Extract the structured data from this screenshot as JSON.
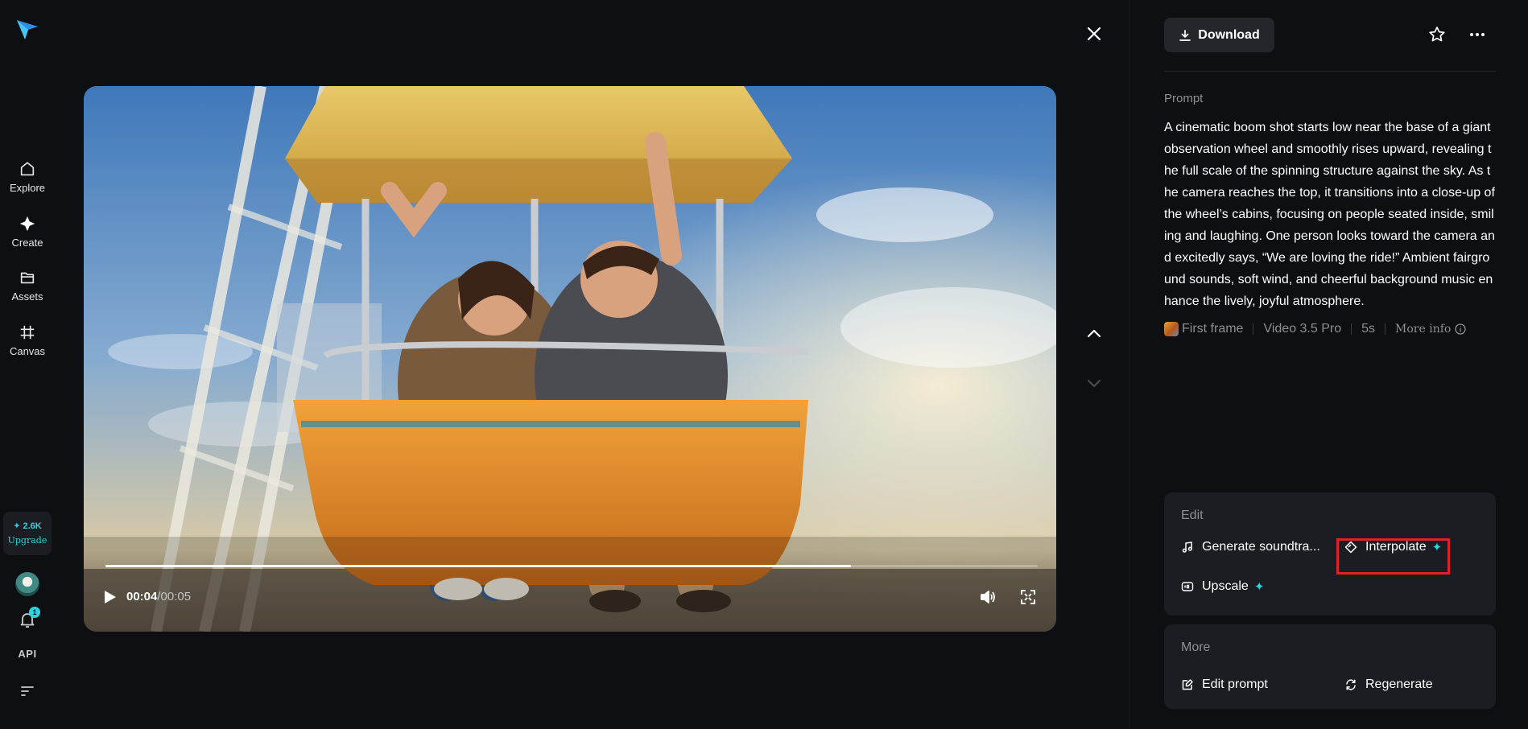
{
  "sidebar": {
    "items": [
      {
        "label": "Explore",
        "icon": "home-icon"
      },
      {
        "label": "Create",
        "icon": "sparkle-icon"
      },
      {
        "label": "Assets",
        "icon": "folder-icon"
      },
      {
        "label": "Canvas",
        "icon": "canvas-icon"
      }
    ],
    "upgrade": {
      "credits": "✦ 2.6K",
      "label": "Upgrade"
    },
    "notifications_count": "1",
    "api_label": "API"
  },
  "player": {
    "current_time": "00:04",
    "separator": "/",
    "duration": "00:05",
    "progress_fraction": 0.8
  },
  "panel": {
    "download_label": "Download",
    "prompt_label": "Prompt",
    "prompt_text": "A cinematic boom shot starts low near the base of a giant observation wheel and smoothly rises upward, revealing the full scale of the spinning structure against the sky. As the camera reaches the top, it transitions into a close-up of the wheel’s cabins, focusing on people seated inside, smiling and laughing. One person looks toward the camera and excitedly says, “We are loving the ride!” Ambient fairground sounds, soft wind, and cheerful background music enhance the lively, joyful atmosphere.",
    "meta": {
      "first_frame": "First frame",
      "model": "Video 3.5 Pro",
      "duration": "5s",
      "more_info": "More info"
    },
    "edit": {
      "title": "Edit",
      "generate_soundtrack": "Generate soundtra...",
      "interpolate": "Interpolate",
      "upscale": "Upscale"
    },
    "more": {
      "title": "More",
      "edit_prompt": "Edit prompt",
      "regenerate": "Regenerate"
    }
  },
  "colors": {
    "background": "#0e0f12",
    "card": "#1c1d22",
    "accent": "#2ed3de",
    "highlight": "#e0202a"
  }
}
